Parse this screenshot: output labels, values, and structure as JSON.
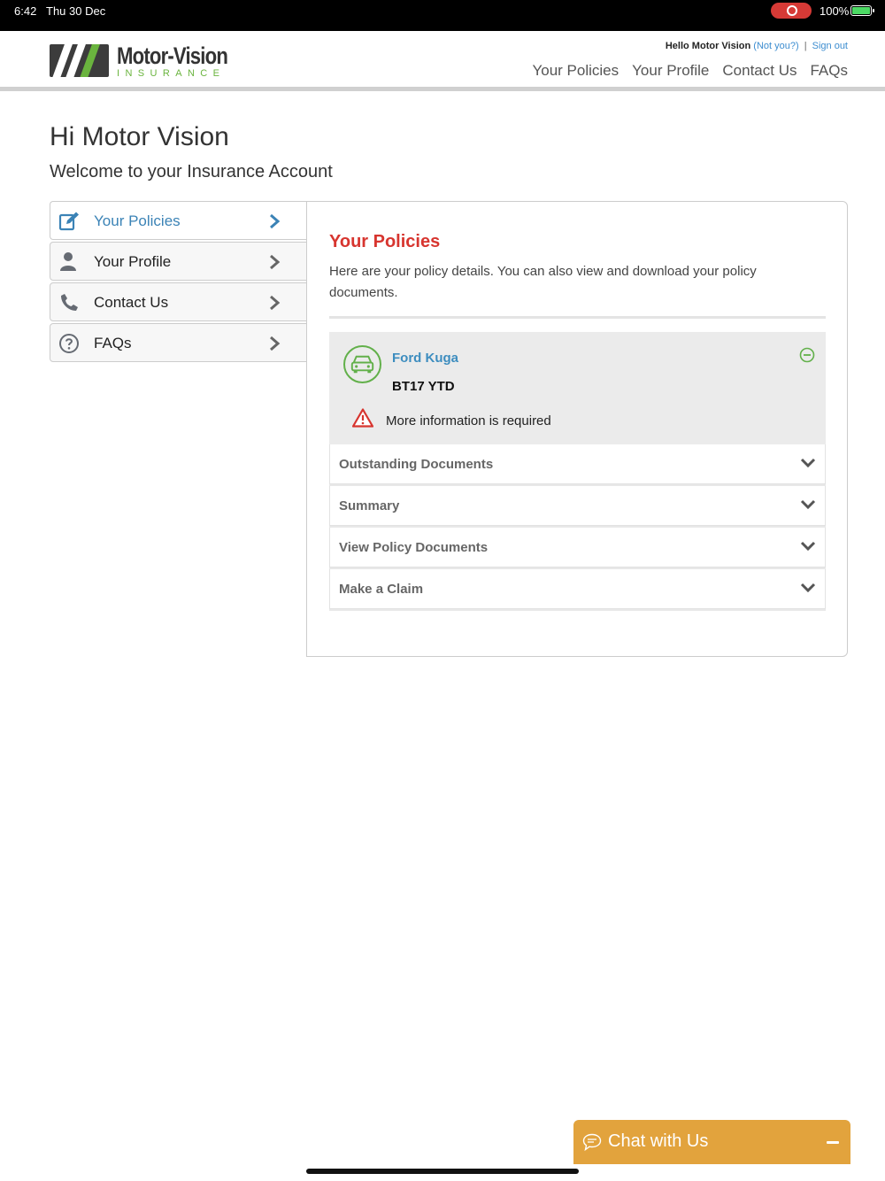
{
  "status_bar": {
    "time": "6:42",
    "date": "Thu 30 Dec",
    "battery": "100%"
  },
  "header": {
    "logo": {
      "wordmark": "Motor-Vision",
      "subtitle": "INSURANCE"
    },
    "greeting": "Hello Motor Vision",
    "not_you": "(Not you?)",
    "separator": "|",
    "sign_out": "Sign out",
    "nav": [
      "Your Policies",
      "Your Profile",
      "Contact Us",
      "FAQs"
    ]
  },
  "page": {
    "title": "Hi Motor Vision",
    "subtitle": "Welcome to your Insurance Account"
  },
  "sidebar": {
    "items": [
      {
        "label": "Your Policies",
        "icon": "edit-icon",
        "active": true
      },
      {
        "label": "Your Profile",
        "icon": "user-icon",
        "active": false
      },
      {
        "label": "Contact Us",
        "icon": "phone-icon",
        "active": false
      },
      {
        "label": "FAQs",
        "icon": "question-icon",
        "active": false
      }
    ]
  },
  "content": {
    "title": "Your Policies",
    "description": "Here are your policy details. You can also view and download your policy documents.",
    "policy": {
      "vehicle": "Ford Kuga",
      "registration": "BT17 YTD",
      "warning": "More information is required"
    },
    "sections": [
      "Outstanding Documents",
      "Summary",
      "View Policy Documents",
      "Make a Claim"
    ]
  },
  "chat": {
    "label": "Chat with Us"
  },
  "colors": {
    "brand_green": "#6ab43e",
    "accent_red": "#d7352f",
    "link_blue": "#3d8dbf",
    "chat_orange": "#e2a33d"
  }
}
